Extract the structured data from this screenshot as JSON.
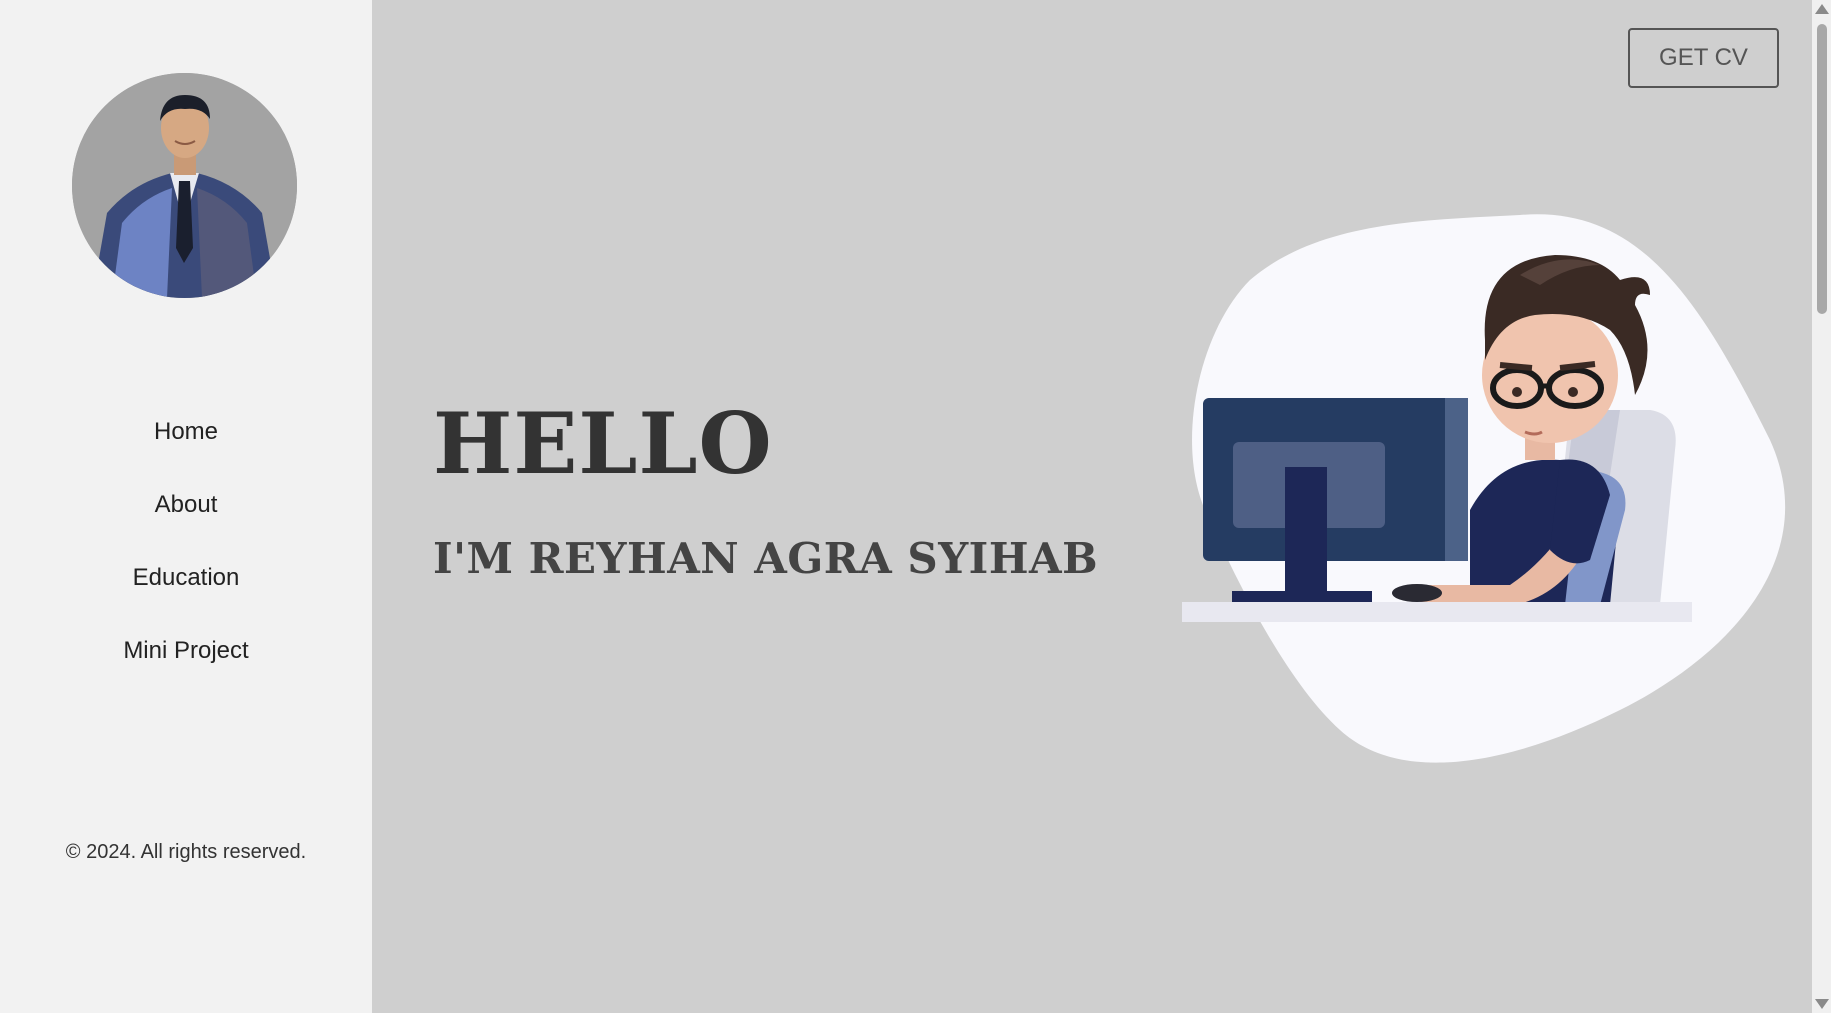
{
  "sidebar": {
    "nav_items": [
      {
        "label": "Home"
      },
      {
        "label": "About"
      },
      {
        "label": "Education"
      },
      {
        "label": "Mini Project"
      }
    ],
    "copyright": "© 2024. All rights reserved."
  },
  "header": {
    "cv_button": "GET CV"
  },
  "hero": {
    "greeting": "HELLO",
    "subtitle": "I'M REYHAN AGRA SYIHAB"
  },
  "colors": {
    "background": "#cfcfcf",
    "sidebar": "#f2f2f2",
    "text_dark": "#333333",
    "blob": "#f9f9fd",
    "monitor": "#253c62",
    "shirt": "#1d2757"
  }
}
